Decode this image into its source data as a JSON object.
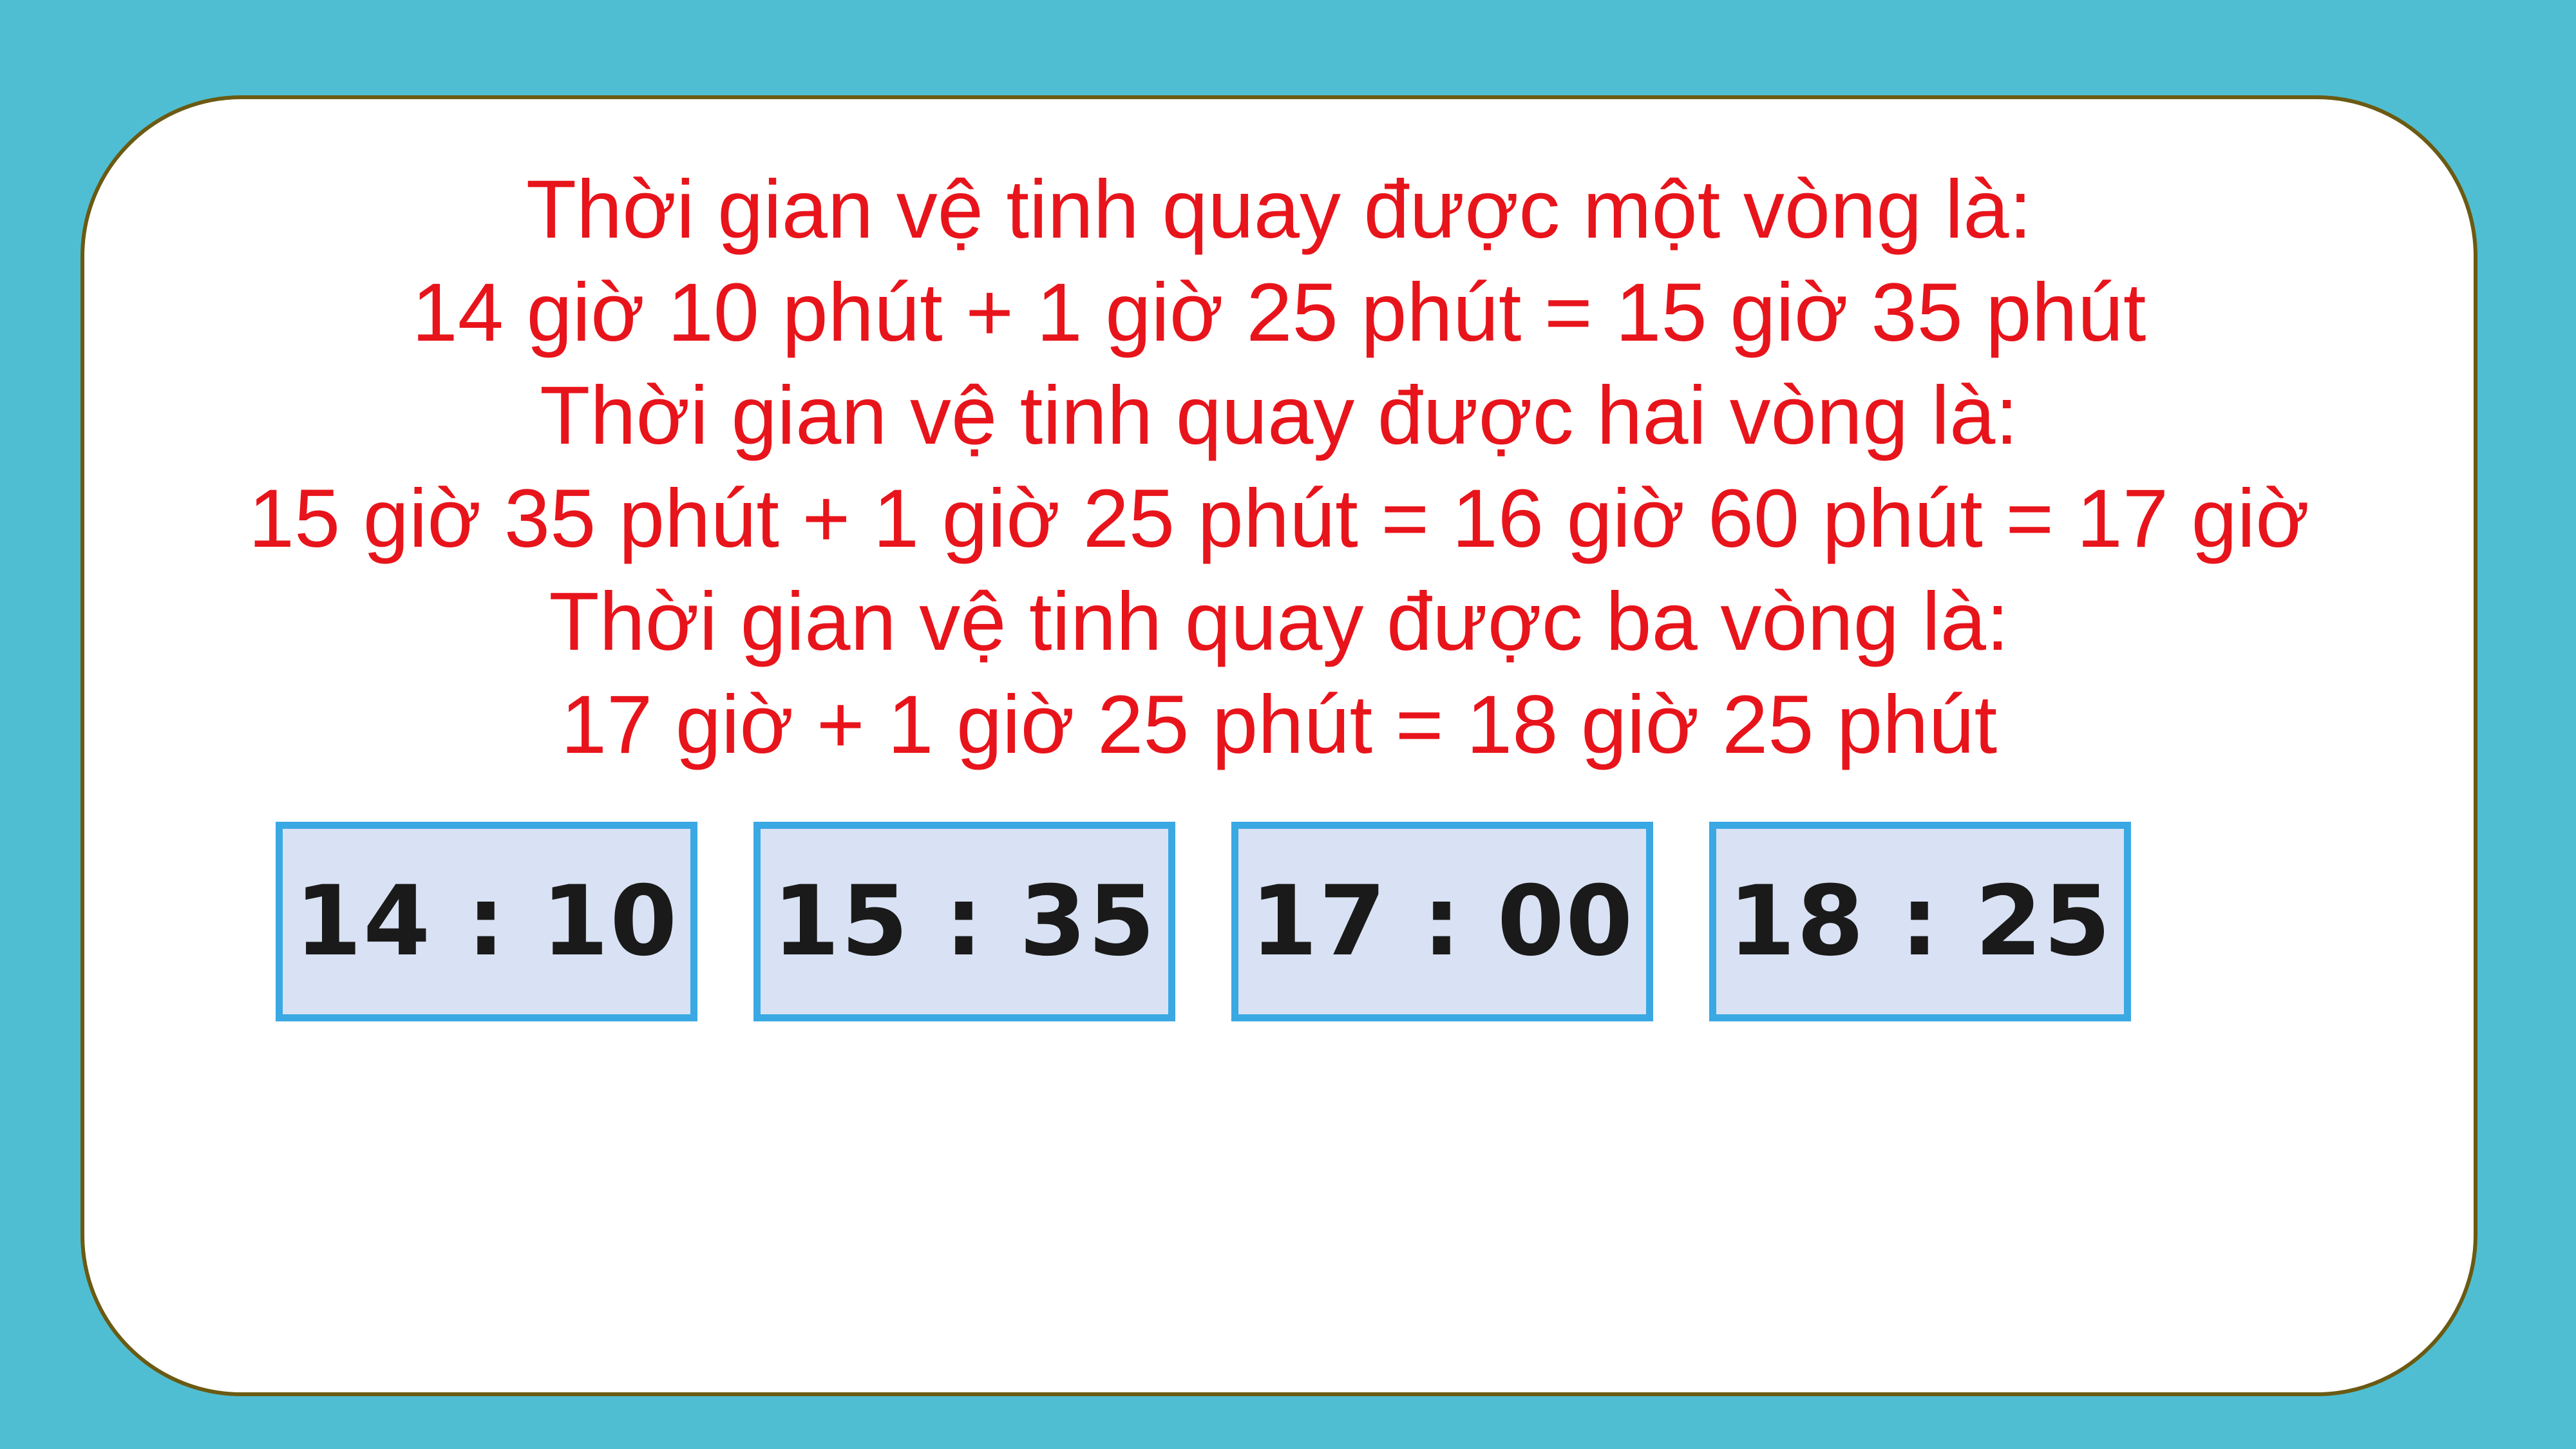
{
  "solution": {
    "lines": [
      "Thời gian vệ tinh quay được một vòng là:",
      "14 giờ 10 phút + 1 giờ 25 phút = 15 giờ 35 phút",
      "Thời gian vệ tinh quay được hai vòng là:",
      "15 giờ 35 phút + 1 giờ 25 phút = 16 giờ 60 phút = 17 giờ",
      "Thời gian vệ tinh quay được ba vòng là:",
      "17 giờ + 1 giờ 25 phút = 18 giờ 25 phút"
    ]
  },
  "clocks": [
    "14 : 10",
    "15 : 35",
    "17 : 00",
    "18 : 25"
  ],
  "colors": {
    "background": "#50BED2",
    "card": "#FFFFFF",
    "card_border": "#6B5A12",
    "text": "#E8141B",
    "clock_fill": "#D9E2F4",
    "clock_border": "#3AA8E2"
  }
}
